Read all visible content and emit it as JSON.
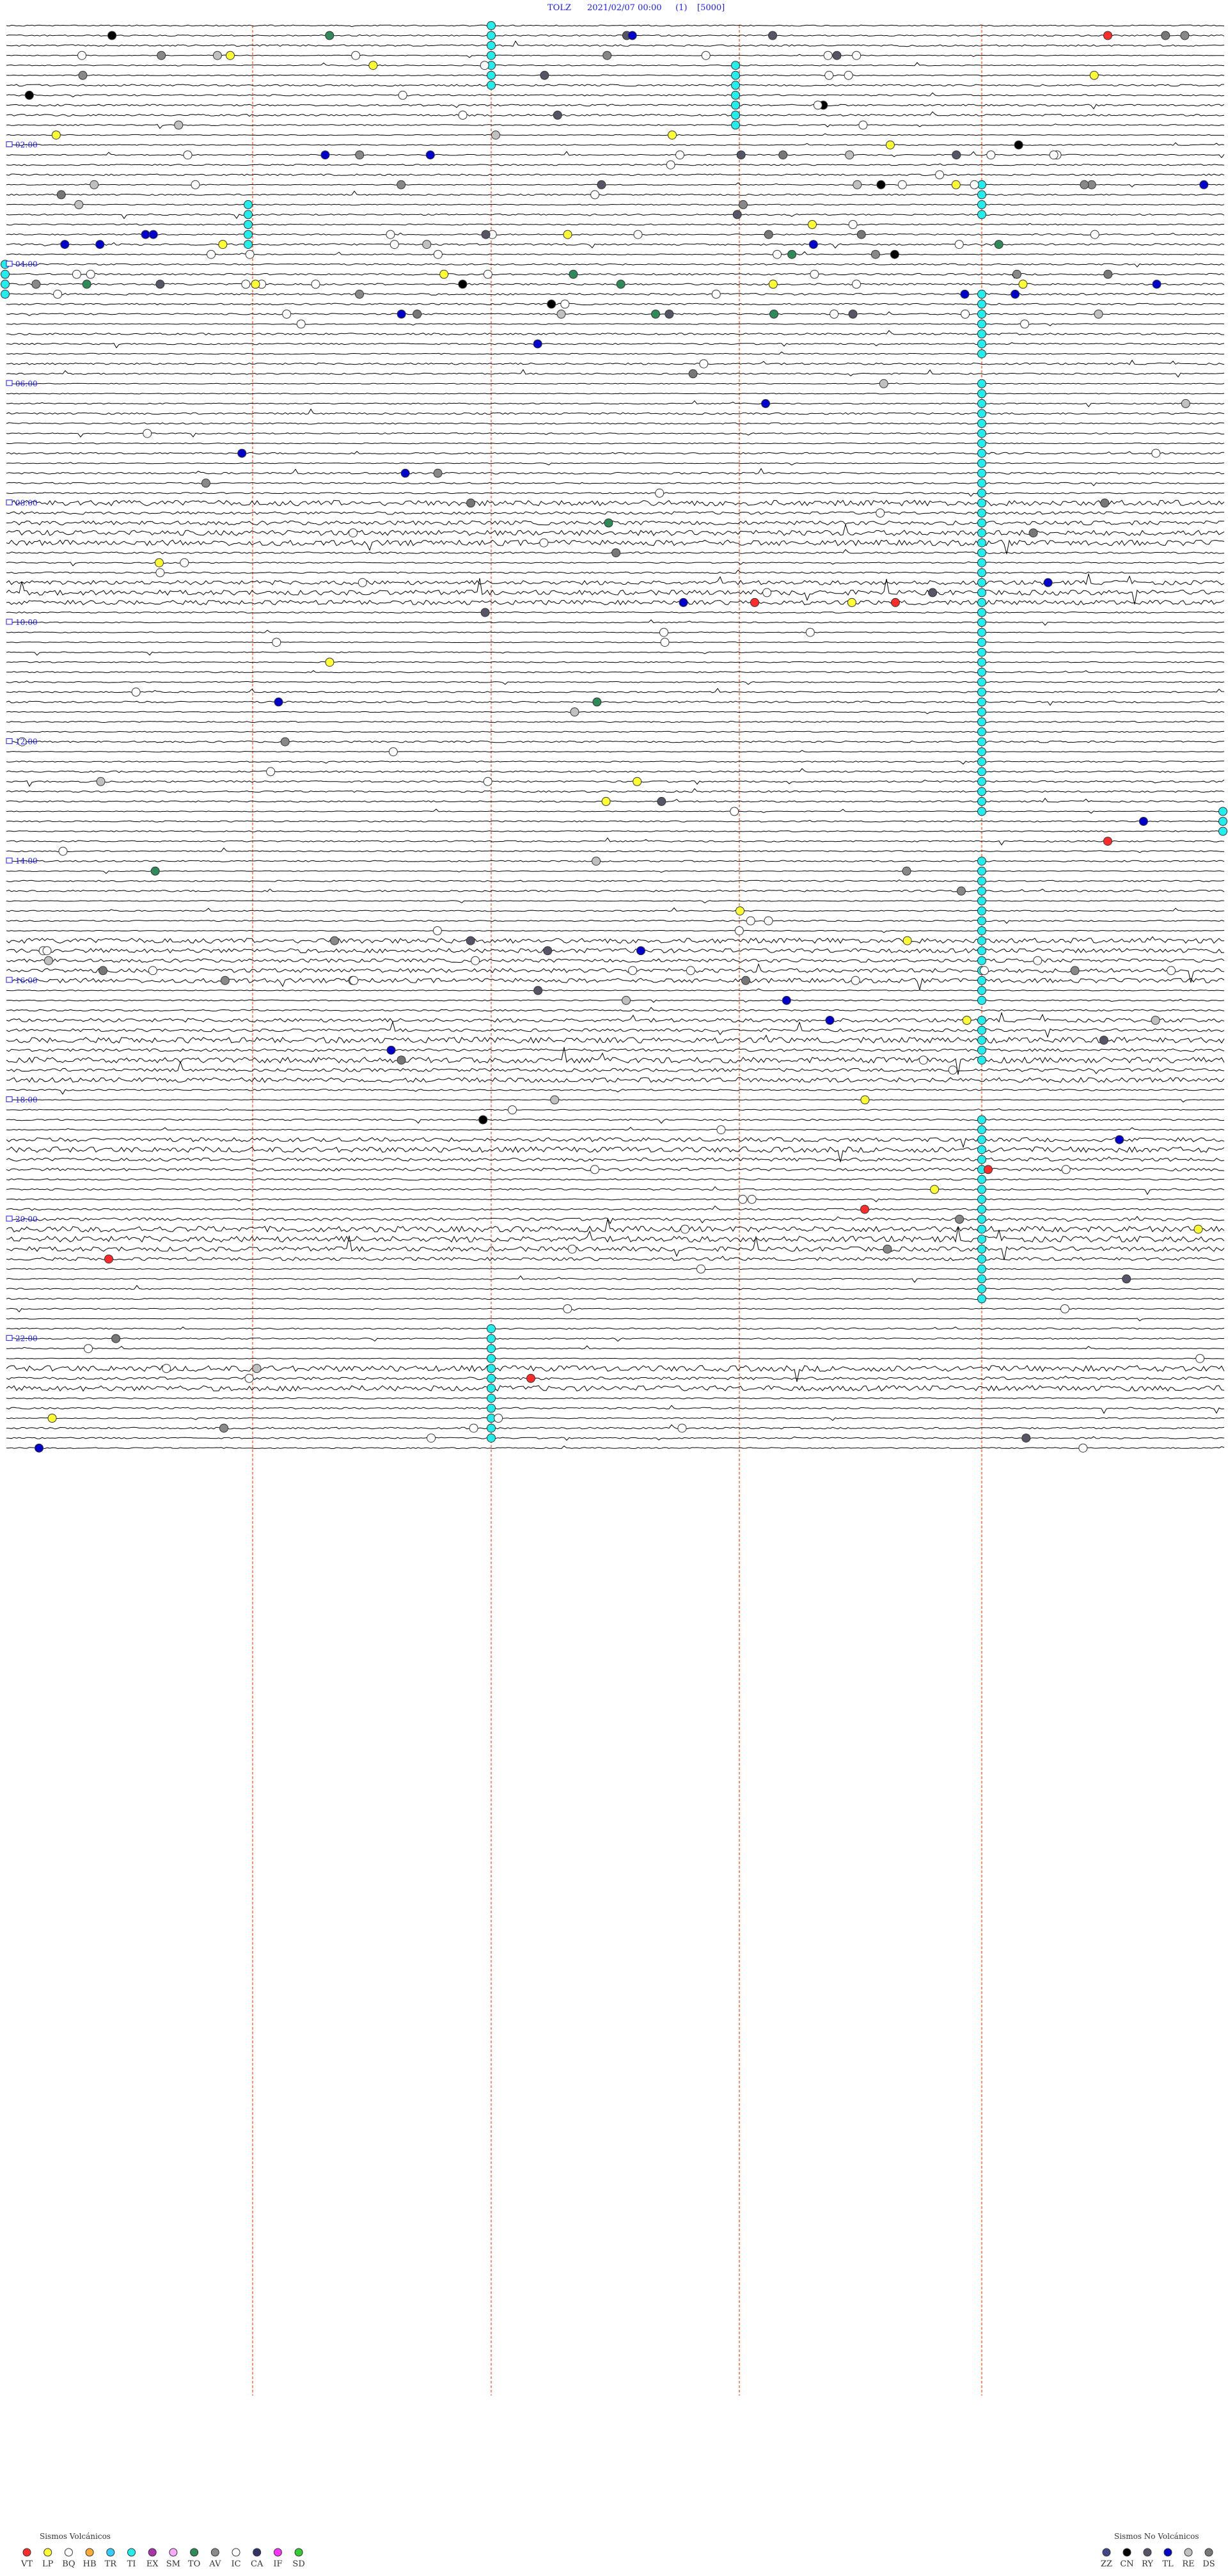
{
  "header": {
    "station": "TOLZ",
    "datetime": "2021/02/07 00:00",
    "channel": "(1)",
    "scale": "[5000]"
  },
  "chart_data": {
    "type": "helicorder",
    "rows": 144,
    "minutes_per_row": 10,
    "hour_labels": [
      "02:00",
      "04:00",
      "06:00",
      "08:00",
      "10:00",
      "12:00",
      "14:00",
      "16:00",
      "18:00",
      "20:00",
      "22:00"
    ],
    "colors": {
      "trace": "#000000",
      "marker_line": "#ff6b3d",
      "hour_label": "#1a1aff",
      "VT": "#ff2a2a",
      "LP": "#ffff33",
      "BQ": "#ffffff",
      "HB": "#ffaa33",
      "TR": "#33ccff",
      "TI": "#22eeee",
      "EX": "#aa33aa",
      "SM": "#ffaaff",
      "TO": "#2f8a5a",
      "AV": "#888888",
      "IC": "#ffffff",
      "CA": "#333366",
      "IF": "#ff33ff",
      "SD": "#33cc33",
      "ZZ": "#444488",
      "CN": "#000000",
      "RY": "#555566",
      "TL": "#0000cc",
      "RE": "#c0c0c0",
      "DS": "#777777"
    },
    "volcanic_legend": {
      "title": "Sismos Volcánicos",
      "codes": [
        "VT",
        "LP",
        "BQ",
        "HB",
        "TR",
        "TI",
        "EX",
        "SM",
        "TO",
        "AV",
        "IC",
        "CA",
        "IF",
        "SD"
      ]
    },
    "non_volcanic_legend": {
      "title": "Sismos No Volcánicos",
      "codes": [
        "ZZ",
        "CN",
        "RY",
        "TL",
        "RE",
        "DS"
      ]
    }
  }
}
